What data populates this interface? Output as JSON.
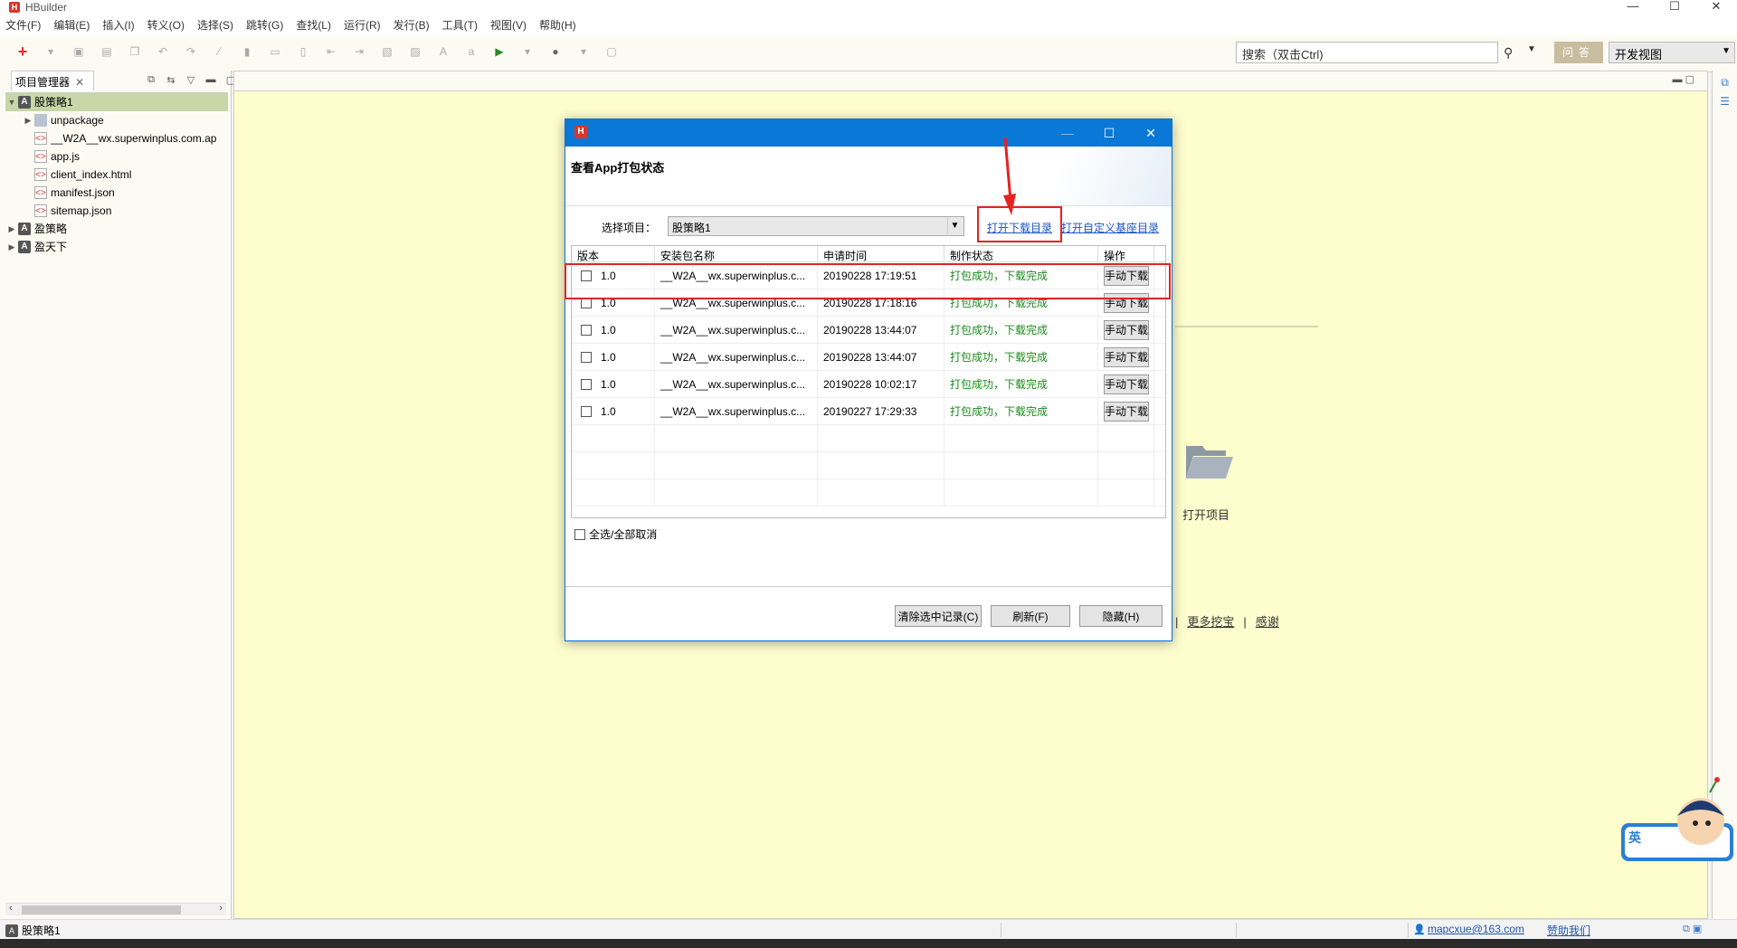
{
  "window": {
    "title": "HBuilder",
    "min": "—",
    "max": "☐",
    "close": "✕"
  },
  "menu": [
    "文件(F)",
    "编辑(E)",
    "插入(I)",
    "转义(O)",
    "选择(S)",
    "跳转(G)",
    "查找(L)",
    "运行(R)",
    "发行(B)",
    "工具(T)",
    "视图(V)",
    "帮助(H)"
  ],
  "toolbar": {
    "search_placeholder": "搜索（双击Ctrl)",
    "qa_label": "问答",
    "view_label": "开发视图"
  },
  "project_manager": {
    "tab_label": "项目管理器",
    "tree": [
      {
        "label": "股策略1",
        "level": 0,
        "expanded": true,
        "selected": true,
        "type": "project"
      },
      {
        "label": "unpackage",
        "level": 1,
        "type": "folder"
      },
      {
        "label": "__W2A__wx.superwinplus.com.ap",
        "level": 1,
        "type": "file"
      },
      {
        "label": "app.js",
        "level": 1,
        "type": "file"
      },
      {
        "label": "client_index.html",
        "level": 1,
        "type": "file"
      },
      {
        "label": "manifest.json",
        "level": 1,
        "type": "file"
      },
      {
        "label": "sitemap.json",
        "level": 1,
        "type": "file"
      },
      {
        "label": "盈策略",
        "level": 0,
        "type": "project"
      },
      {
        "label": "盈天下",
        "level": 0,
        "type": "project"
      }
    ]
  },
  "welcome": {
    "open_project": "打开项目",
    "links": [
      "更多挖宝",
      "感谢"
    ]
  },
  "mascot": {
    "badge": "英"
  },
  "statusbar": {
    "project": "股策略1",
    "user": "mapcxue@163.com",
    "help": "赞助我们"
  },
  "dialog": {
    "heading": "查看App打包状态",
    "select_label": "选择项目：",
    "selected_project": "股策略1",
    "link_download_dir": "打开下载目录",
    "link_custom_dir": "打开自定义基座目录",
    "columns": [
      "版本",
      "安装包名称",
      "申请时间",
      "制作状态",
      "操作"
    ],
    "rows": [
      {
        "version": "1.0",
        "name": "__W2A__wx.superwinplus.c...",
        "time": "20190228 17:19:51",
        "status": "打包成功，下载完成",
        "action": "手动下载"
      },
      {
        "version": "1.0",
        "name": "__W2A__wx.superwinplus.c...",
        "time": "20190228 17:18:16",
        "status": "打包成功，下载完成",
        "action": "手动下载"
      },
      {
        "version": "1.0",
        "name": "__W2A__wx.superwinplus.c...",
        "time": "20190228 13:44:07",
        "status": "打包成功，下载完成",
        "action": "手动下载"
      },
      {
        "version": "1.0",
        "name": "__W2A__wx.superwinplus.c...",
        "time": "20190228 13:44:07",
        "status": "打包成功，下载完成",
        "action": "手动下载"
      },
      {
        "version": "1.0",
        "name": "__W2A__wx.superwinplus.c...",
        "time": "20190228 10:02:17",
        "status": "打包成功，下载完成",
        "action": "手动下载"
      },
      {
        "version": "1.0",
        "name": "__W2A__wx.superwinplus.c...",
        "time": "20190227 17:29:33",
        "status": "打包成功，下载完成",
        "action": "手动下载"
      }
    ],
    "select_all": "全选/全部取消",
    "btn_clear": "清除选中记录(C)",
    "btn_refresh": "刷新(F)",
    "btn_hide": "隐藏(H)"
  },
  "colors": {
    "accent_blue": "#0a78d7",
    "highlight_red": "#e62222",
    "status_green": "#1a8a1a",
    "editor_bg": "#fdfdcd"
  }
}
